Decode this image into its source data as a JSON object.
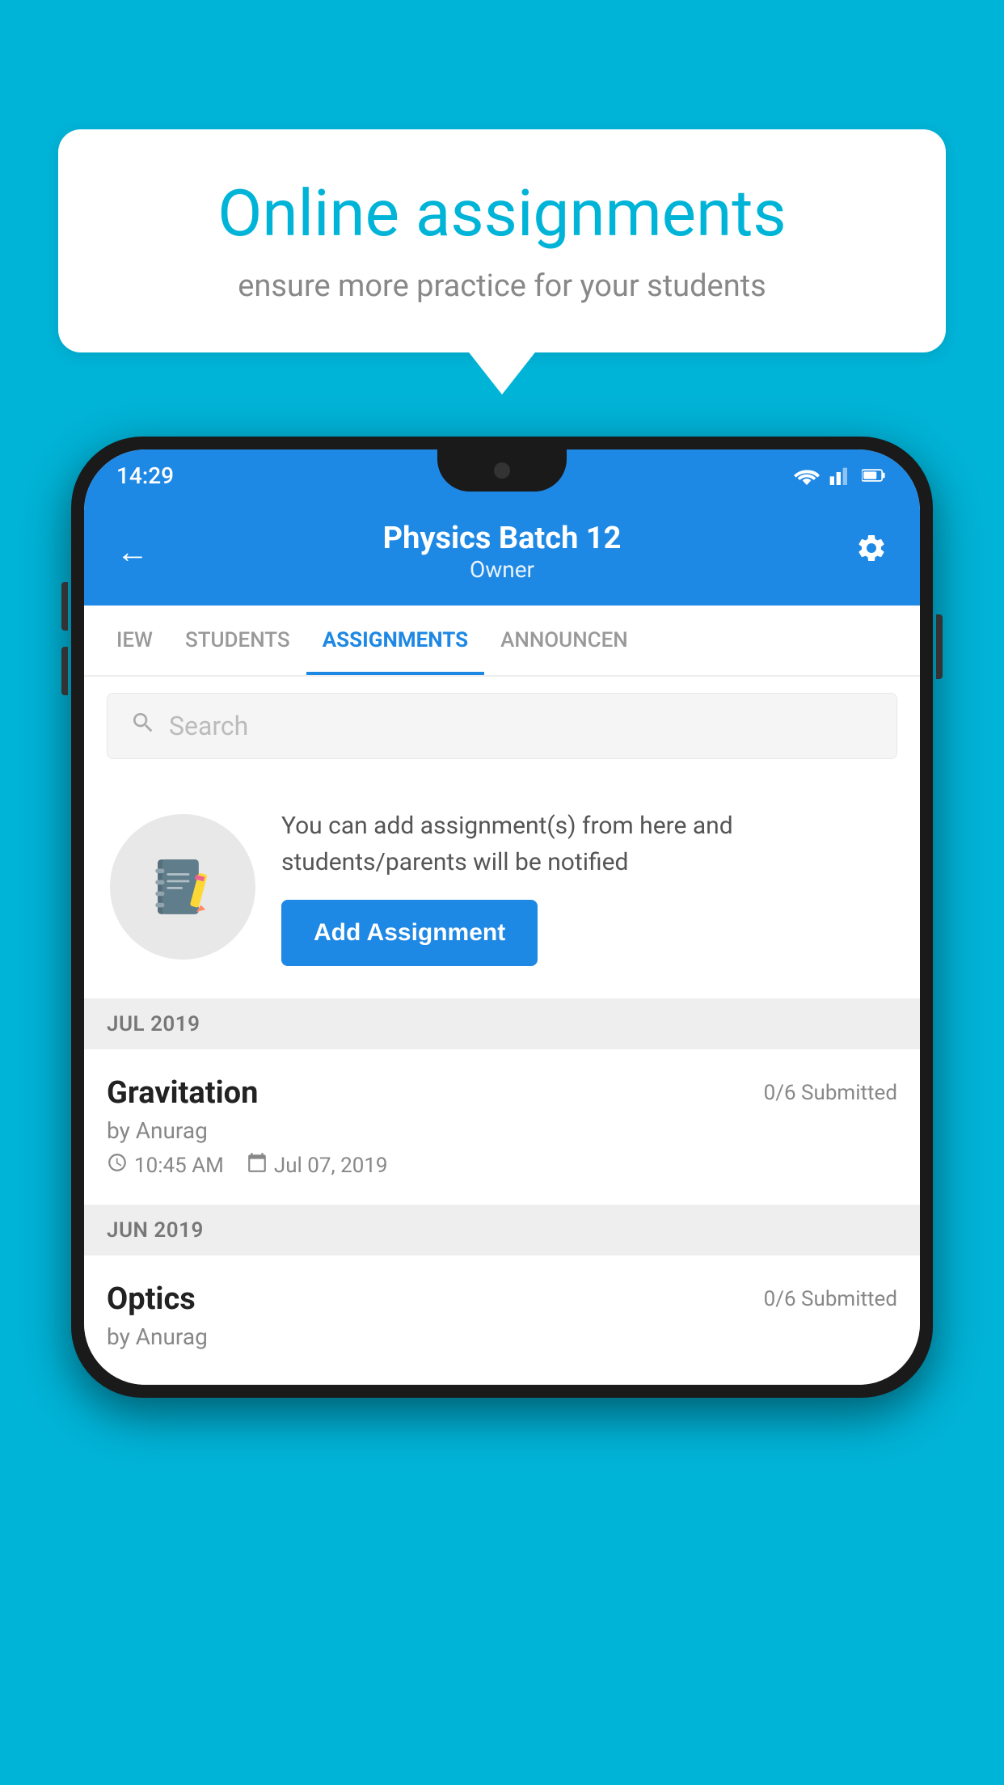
{
  "background_color": "#00B4D8",
  "speech_bubble": {
    "title": "Online assignments",
    "subtitle": "ensure more practice for your students"
  },
  "phone": {
    "status_bar": {
      "time": "14:29"
    },
    "header": {
      "title": "Physics Batch 12",
      "subtitle": "Owner",
      "back_label": "←",
      "settings_label": "⚙"
    },
    "tabs": [
      {
        "label": "IEW",
        "active": false
      },
      {
        "label": "STUDENTS",
        "active": false
      },
      {
        "label": "ASSIGNMENTS",
        "active": true
      },
      {
        "label": "ANNOUNCEN",
        "active": false
      }
    ],
    "search": {
      "placeholder": "Search"
    },
    "promo": {
      "description": "You can add assignment(s) from here and students/parents will be notified",
      "button_label": "Add Assignment"
    },
    "sections": [
      {
        "header": "JUL 2019",
        "assignments": [
          {
            "title": "Gravitation",
            "submitted": "0/6 Submitted",
            "author": "by Anurag",
            "time": "10:45 AM",
            "date": "Jul 07, 2019"
          }
        ]
      },
      {
        "header": "JUN 2019",
        "assignments": [
          {
            "title": "Optics",
            "submitted": "0/6 Submitted",
            "author": "by Anurag",
            "time": "",
            "date": ""
          }
        ]
      }
    ]
  }
}
